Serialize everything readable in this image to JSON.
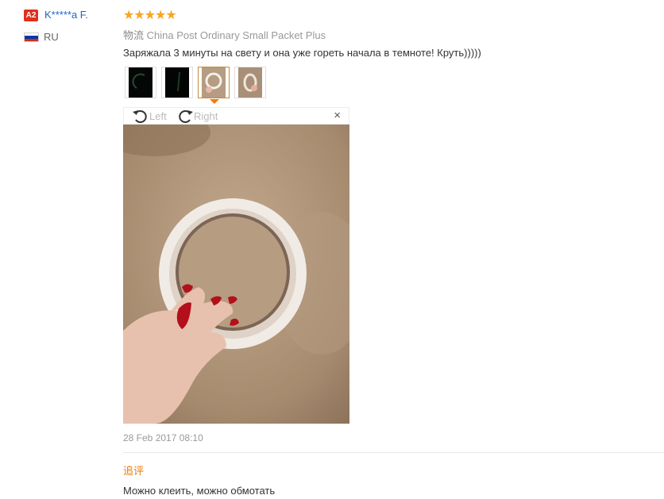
{
  "reviewer": {
    "badge": "A2",
    "name": "K*****a F.",
    "country": "RU",
    "flag_colors": [
      "#ffffff",
      "#0039a6",
      "#d52b1e"
    ]
  },
  "review": {
    "rating": 5,
    "stars": "★★★★★",
    "shipping_label": "物流",
    "shipping_method": "China Post Ordinary Small Packet Plus",
    "text": "Заряжала 3 минуты на свету и она уже гореть начала в темноте! Круть)))))",
    "thumbnail_icons": [
      "glow-dark-photo-icon",
      "glow-dark-photo-icon",
      "tape-ring-photo-icon",
      "tape-ring-photo-icon"
    ],
    "active_thumbnail": 3,
    "date": "28 Feb 2017 08:10"
  },
  "viewer": {
    "rotate_left": "Left",
    "rotate_right": "Right",
    "close": "×"
  },
  "additional": {
    "label": "追评",
    "text": "Можно клеить, можно обмотать"
  },
  "colors": {
    "accent": "#f07c00",
    "star": "#f5a623",
    "link": "#2264c8",
    "badge": "#e0301e"
  }
}
